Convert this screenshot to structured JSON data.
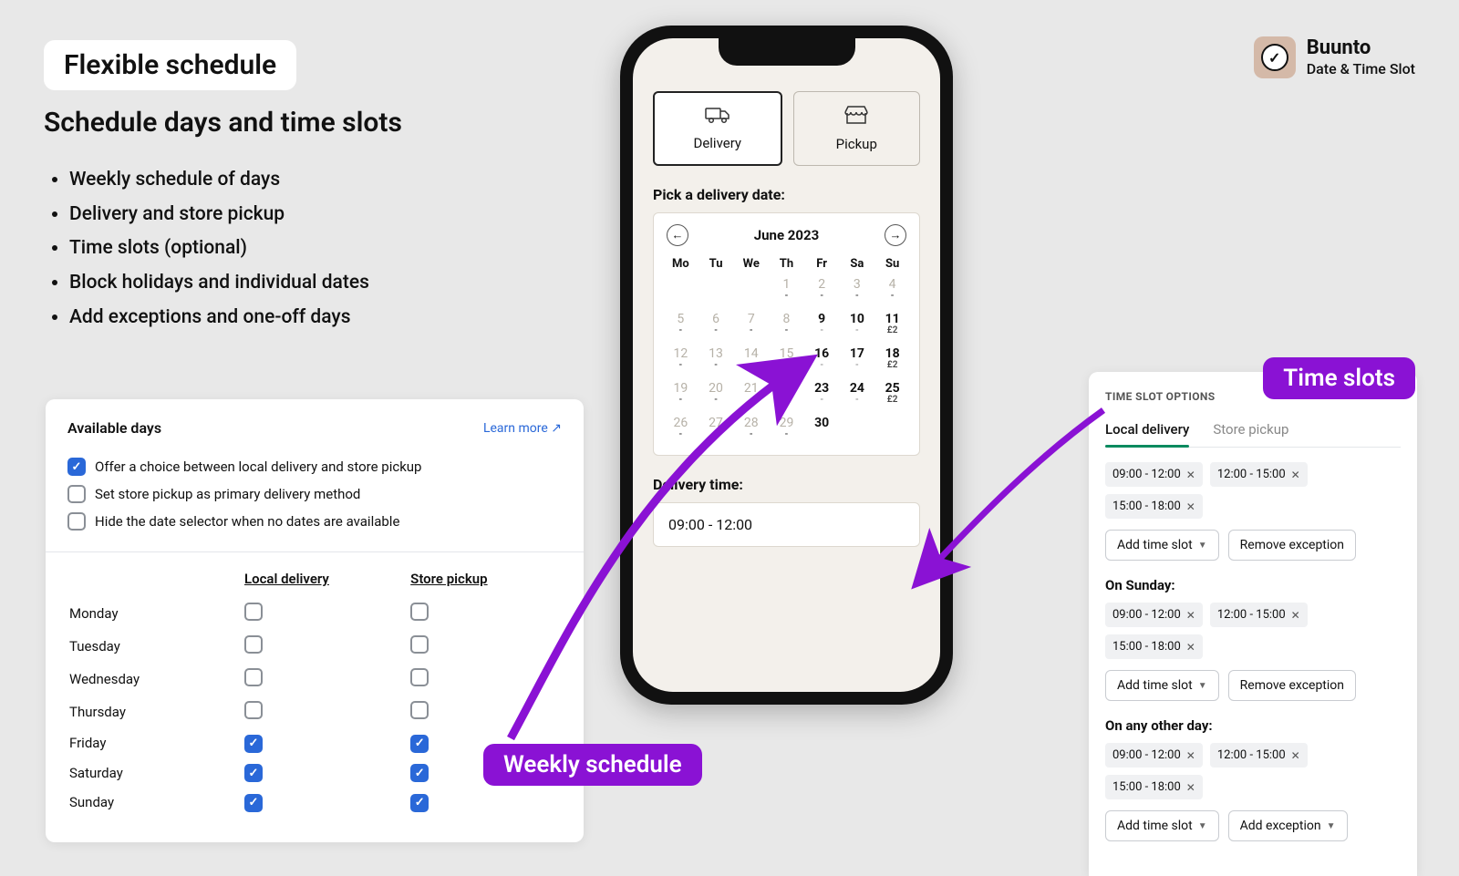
{
  "hero": {
    "title": "Flexible schedule",
    "subtitle": "Schedule days and time slots",
    "bullets": [
      "Weekly schedule of days",
      "Delivery and store pickup",
      "Time slots (optional)",
      "Block holidays and individual dates",
      "Add exceptions and one-off days"
    ]
  },
  "brand": {
    "name": "Buunto",
    "tagline": "Date & Time Slot"
  },
  "available_days": {
    "title": "Available days",
    "learn_more": "Learn more",
    "opts": [
      {
        "label": "Offer a choice between local delivery and store pickup",
        "checked": true
      },
      {
        "label": "Set store pickup as primary delivery method",
        "checked": false
      },
      {
        "label": "Hide the date selector when no dates are available",
        "checked": false
      }
    ],
    "columns": [
      "Local delivery",
      "Store pickup"
    ],
    "rows": [
      {
        "day": "Monday",
        "local": false,
        "pickup": false
      },
      {
        "day": "Tuesday",
        "local": false,
        "pickup": false
      },
      {
        "day": "Wednesday",
        "local": false,
        "pickup": false
      },
      {
        "day": "Thursday",
        "local": false,
        "pickup": false
      },
      {
        "day": "Friday",
        "local": true,
        "pickup": true
      },
      {
        "day": "Saturday",
        "local": true,
        "pickup": true
      },
      {
        "day": "Sunday",
        "local": true,
        "pickup": true
      }
    ]
  },
  "phone": {
    "methods": {
      "delivery": "Delivery",
      "pickup": "Pickup"
    },
    "pick_label": "Pick a delivery date:",
    "month": "June 2023",
    "dow": [
      "Mo",
      "Tu",
      "We",
      "Th",
      "Fr",
      "Sa",
      "Su"
    ],
    "price_label": "£2",
    "delivery_time_label": "Delivery time:",
    "delivery_time_value": "09:00 - 12:00"
  },
  "slots": {
    "heading": "TIME SLOT OPTIONS",
    "tabs": {
      "local": "Local delivery",
      "pickup": "Store pickup"
    },
    "chips": [
      "09:00 - 12:00",
      "12:00 - 15:00",
      "15:00 - 18:00"
    ],
    "buttons": {
      "add": "Add time slot",
      "remove": "Remove exception",
      "add_exc": "Add exception"
    },
    "labels": {
      "sunday": "On Sunday:",
      "any": "On any other day:"
    }
  },
  "callouts": {
    "weekly": "Weekly schedule",
    "slots": "Time slots"
  }
}
